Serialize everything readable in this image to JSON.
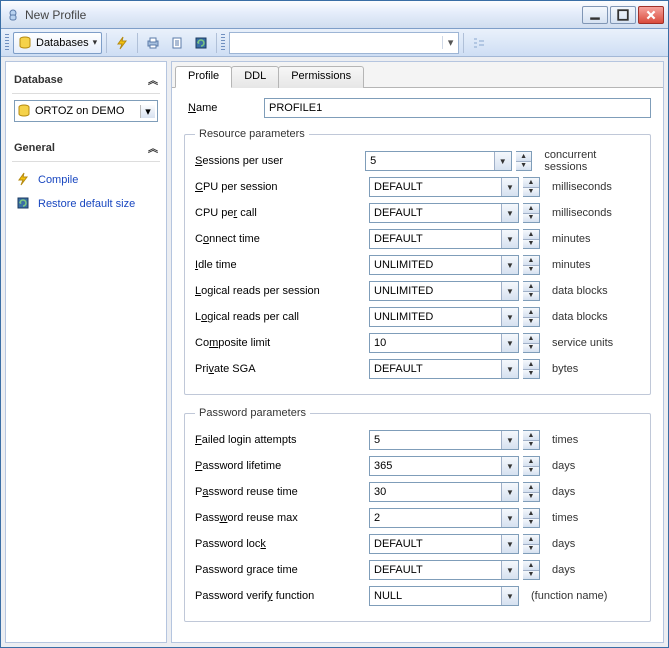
{
  "window": {
    "title": "New Profile"
  },
  "toolbar": {
    "db_button_label": "Databases"
  },
  "sidebar": {
    "database_header": "Database",
    "selected_db": "ORTOZ on DEMO",
    "general_header": "General",
    "links": [
      {
        "label": "Compile",
        "name": "compile-link",
        "icon": "bolt-icon"
      },
      {
        "label": "Restore default size",
        "name": "restore-size-link",
        "icon": "restore-icon"
      }
    ]
  },
  "tabs": [
    {
      "label": "Profile",
      "name": "tab-profile",
      "active": true
    },
    {
      "label": "DDL",
      "name": "tab-ddl",
      "active": false
    },
    {
      "label": "Permissions",
      "name": "tab-permissions",
      "active": false
    }
  ],
  "profile": {
    "name_label": "Name",
    "name_underline": "N",
    "name_value": "PROFILE1",
    "resource_legend": "Resource parameters",
    "password_legend": "Password parameters",
    "resource_params": [
      {
        "label_pre": "",
        "u": "S",
        "label_post": "essions per user",
        "value": "5",
        "unit": "concurrent sessions",
        "spinner": true,
        "name": "sessions-per-user"
      },
      {
        "label_pre": "",
        "u": "C",
        "label_post": "PU per session",
        "value": "DEFAULT",
        "unit": "milliseconds",
        "spinner": true,
        "name": "cpu-per-session"
      },
      {
        "label_pre": "CPU pe",
        "u": "r",
        "label_post": " call",
        "value": "DEFAULT",
        "unit": "milliseconds",
        "spinner": true,
        "name": "cpu-per-call"
      },
      {
        "label_pre": "C",
        "u": "o",
        "label_post": "nnect time",
        "value": "DEFAULT",
        "unit": "minutes",
        "spinner": true,
        "name": "connect-time"
      },
      {
        "label_pre": "",
        "u": "I",
        "label_post": "dle time",
        "value": "UNLIMITED",
        "unit": "minutes",
        "spinner": true,
        "name": "idle-time"
      },
      {
        "label_pre": "",
        "u": "L",
        "label_post": "ogical reads per session",
        "value": "UNLIMITED",
        "unit": "data blocks",
        "spinner": true,
        "name": "logical-reads-session"
      },
      {
        "label_pre": "L",
        "u": "o",
        "label_post": "gical reads per call",
        "value": "UNLIMITED",
        "unit": "data blocks",
        "spinner": true,
        "name": "logical-reads-call"
      },
      {
        "label_pre": "Co",
        "u": "m",
        "label_post": "posite limit",
        "value": "10",
        "unit": "service units",
        "spinner": true,
        "name": "composite-limit"
      },
      {
        "label_pre": "Pri",
        "u": "v",
        "label_post": "ate SGA",
        "value": "DEFAULT",
        "unit": "bytes",
        "spinner": true,
        "name": "private-sga"
      }
    ],
    "password_params": [
      {
        "label_pre": "",
        "u": "F",
        "label_post": "ailed login attempts",
        "value": "5",
        "unit": "times",
        "spinner": true,
        "name": "failed-login-attempts"
      },
      {
        "label_pre": "",
        "u": "P",
        "label_post": "assword lifetime",
        "value": "365",
        "unit": "days",
        "spinner": true,
        "name": "password-lifetime"
      },
      {
        "label_pre": "P",
        "u": "a",
        "label_post": "ssword reuse time",
        "value": "30",
        "unit": "days",
        "spinner": true,
        "name": "password-reuse-time"
      },
      {
        "label_pre": "Pass",
        "u": "w",
        "label_post": "ord reuse max",
        "value": "2",
        "unit": "times",
        "spinner": true,
        "name": "password-reuse-max"
      },
      {
        "label_pre": "Password loc",
        "u": "k",
        "label_post": "",
        "value": "DEFAULT",
        "unit": "days",
        "spinner": true,
        "name": "password-lock"
      },
      {
        "label_pre": "Password ",
        "u": "g",
        "label_post": "race time",
        "value": "DEFAULT",
        "unit": "days",
        "spinner": true,
        "name": "password-grace-time"
      },
      {
        "label_pre": "Password verif",
        "u": "y",
        "label_post": " function",
        "value": "NULL",
        "unit": "(function name)",
        "spinner": false,
        "name": "password-verify-function"
      }
    ]
  }
}
